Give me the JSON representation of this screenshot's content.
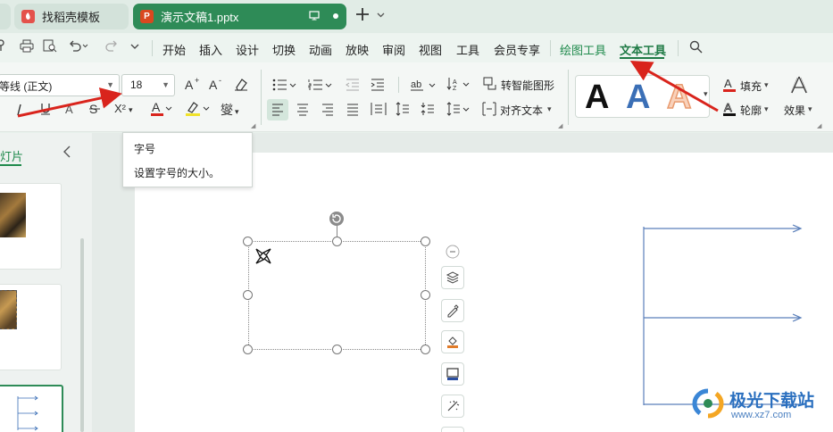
{
  "tabs": {
    "template_label": "找稻壳模板",
    "doc_label": "演示文稿1.pptx",
    "template_icon_letter": "",
    "doc_icon_letter": "P"
  },
  "menu": {
    "items": [
      "开始",
      "插入",
      "设计",
      "切换",
      "动画",
      "放映",
      "审阅",
      "视图",
      "工具",
      "会员专享"
    ],
    "drawing_tools": "绘图工具",
    "text_tools": "文本工具"
  },
  "ribbon": {
    "font_name": "等线 (正文)",
    "font_size": "18",
    "smart_shape": "转智能图形",
    "align_text": "对齐文本",
    "fill_label": "填充",
    "outline_label": "轮廓",
    "effect_label": "效果",
    "superscript": "X²",
    "phonetic": "燮"
  },
  "tooltip": {
    "title": "字号",
    "description": "设置字号的大小。"
  },
  "sidebar": {
    "tab_label": "灯片"
  },
  "watermark": {
    "brand": "极光下载站",
    "url": "www.xz7.com"
  },
  "colors": {
    "accent": "#1f8a4c",
    "tab_active": "#2e8b57",
    "arrow_red": "#d9241c",
    "text_style_blue": "#3b6fb6",
    "text_style_orange": "#f3b38d"
  }
}
